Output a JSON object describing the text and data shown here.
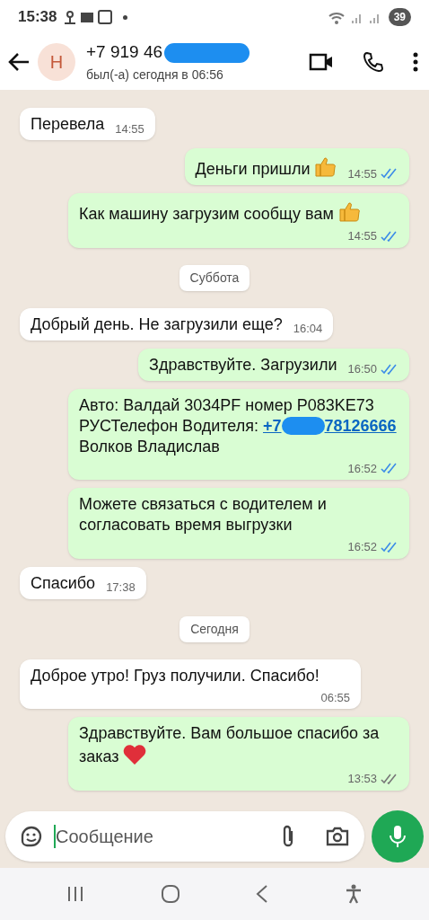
{
  "status_bar": {
    "time": "15:38",
    "battery": "39"
  },
  "header": {
    "avatar_letter": "Н",
    "title": "+7 919 46",
    "subtitle": "был(-а) сегодня в 06:56"
  },
  "messages": [
    {
      "kind": "in",
      "text": "Перевела",
      "time": "14:55"
    },
    {
      "kind": "out",
      "text": "Деньги пришли",
      "emoji": {
        "kind": "thumbs_up"
      },
      "time": "14:55",
      "read": true
    },
    {
      "kind": "out",
      "text": "Как машину загрузим сообщу вам",
      "emoji": {
        "kind": "thumbs_up"
      },
      "time": "14:55",
      "read": true
    },
    {
      "kind": "date",
      "text": "Суббота"
    },
    {
      "kind": "in",
      "text": "Добрый день. Не загрузили еще?",
      "time": "16:04"
    },
    {
      "kind": "out",
      "text": "Здравствуйте.  Загрузили",
      "time": "16:50",
      "read": true
    },
    {
      "kind": "out",
      "text": "Авто: Валдай 3034PF номер P083KE73 РУСТелефон Водителя:",
      "link_start": "+7",
      "link_end": "78126666",
      "text_after": "Волков Владислав",
      "time": "16:52",
      "read": true
    },
    {
      "kind": "out",
      "text": "Можете связаться с водителем и согласовать время выгрузки",
      "time": "16:52",
      "read": true
    },
    {
      "kind": "in",
      "text": "Спасибо",
      "time": "17:38"
    },
    {
      "kind": "date",
      "text": "Сегодня"
    },
    {
      "kind": "in",
      "text": "Доброе утро! Груз получили. Спасибо!",
      "time": "06:55"
    },
    {
      "kind": "out",
      "text": "Здравствуйте.  Вам большое спасибо за заказ",
      "emoji": {
        "kind": "heart"
      },
      "time": "13:53",
      "read": false
    }
  ],
  "composer": {
    "placeholder": "Сообщение"
  }
}
